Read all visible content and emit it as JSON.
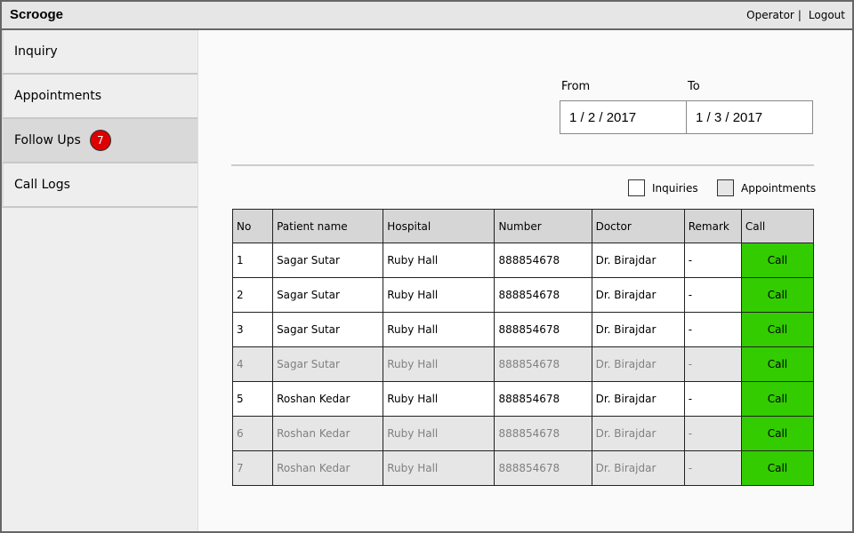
{
  "header": {
    "title": "Scrooge",
    "operator": "Operator",
    "separator": "|",
    "logout": "Logout"
  },
  "sidebar": {
    "items": [
      {
        "label": "Inquiry"
      },
      {
        "label": "Appointments"
      },
      {
        "label": "Follow Ups",
        "badge": "7"
      },
      {
        "label": "Call Logs"
      }
    ]
  },
  "dates": {
    "from_label": "From",
    "from_value": "1 / 2 / 2017",
    "to_label": "To",
    "to_value": "1 / 3 / 2017"
  },
  "filters": {
    "inquiries": "Inquiries",
    "appointments": "Appointments"
  },
  "table": {
    "headers": [
      "No",
      "Patient name",
      "Hospital",
      "Number",
      "Doctor",
      "Remark",
      "Call"
    ],
    "call_label": "Call",
    "rows": [
      {
        "no": "1",
        "name": "Sagar Sutar",
        "hospital": "Ruby Hall",
        "number": "888854678",
        "doctor": "Dr. Birajdar",
        "remark": "-",
        "dim": false
      },
      {
        "no": "2",
        "name": "Sagar Sutar",
        "hospital": "Ruby Hall",
        "number": "888854678",
        "doctor": "Dr. Birajdar",
        "remark": "-",
        "dim": false
      },
      {
        "no": "3",
        "name": "Sagar Sutar",
        "hospital": "Ruby Hall",
        "number": "888854678",
        "doctor": "Dr. Birajdar",
        "remark": "-",
        "dim": false
      },
      {
        "no": "4",
        "name": "Sagar Sutar",
        "hospital": "Ruby Hall",
        "number": "888854678",
        "doctor": "Dr. Birajdar",
        "remark": "-",
        "dim": true
      },
      {
        "no": "5",
        "name": "Roshan Kedar",
        "hospital": "Ruby Hall",
        "number": "888854678",
        "doctor": "Dr. Birajdar",
        "remark": "-",
        "dim": false
      },
      {
        "no": "6",
        "name": "Roshan Kedar",
        "hospital": "Ruby Hall",
        "number": "888854678",
        "doctor": "Dr. Birajdar",
        "remark": "-",
        "dim": true
      },
      {
        "no": "7",
        "name": "Roshan Kedar",
        "hospital": "Ruby Hall",
        "number": "888854678",
        "doctor": "Dr. Birajdar",
        "remark": "-",
        "dim": true
      }
    ]
  },
  "colors": {
    "call_button": "#33cc00",
    "badge": "#dd0000"
  }
}
